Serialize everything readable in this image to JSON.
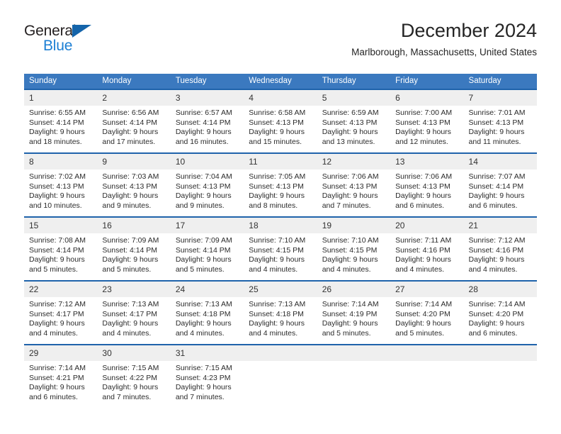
{
  "logo": {
    "word1": "General",
    "word2": "Blue",
    "triangle_color": "#1464aa",
    "blue_color": "#1c7fd4"
  },
  "header": {
    "title": "December 2024",
    "subtitle": "Marlborough, Massachusetts, United States"
  },
  "theme": {
    "header_bg": "#3b79bf",
    "row_divider": "#1f63ab",
    "daynum_bg": "#efefef",
    "text": "#2b2b2b"
  },
  "calendar": {
    "weekday_headers": [
      "Sunday",
      "Monday",
      "Tuesday",
      "Wednesday",
      "Thursday",
      "Friday",
      "Saturday"
    ],
    "weeks": [
      [
        {
          "day": "1",
          "sunrise": "Sunrise: 6:55 AM",
          "sunset": "Sunset: 4:14 PM",
          "daylight1": "Daylight: 9 hours",
          "daylight2": "and 18 minutes."
        },
        {
          "day": "2",
          "sunrise": "Sunrise: 6:56 AM",
          "sunset": "Sunset: 4:14 PM",
          "daylight1": "Daylight: 9 hours",
          "daylight2": "and 17 minutes."
        },
        {
          "day": "3",
          "sunrise": "Sunrise: 6:57 AM",
          "sunset": "Sunset: 4:14 PM",
          "daylight1": "Daylight: 9 hours",
          "daylight2": "and 16 minutes."
        },
        {
          "day": "4",
          "sunrise": "Sunrise: 6:58 AM",
          "sunset": "Sunset: 4:13 PM",
          "daylight1": "Daylight: 9 hours",
          "daylight2": "and 15 minutes."
        },
        {
          "day": "5",
          "sunrise": "Sunrise: 6:59 AM",
          "sunset": "Sunset: 4:13 PM",
          "daylight1": "Daylight: 9 hours",
          "daylight2": "and 13 minutes."
        },
        {
          "day": "6",
          "sunrise": "Sunrise: 7:00 AM",
          "sunset": "Sunset: 4:13 PM",
          "daylight1": "Daylight: 9 hours",
          "daylight2": "and 12 minutes."
        },
        {
          "day": "7",
          "sunrise": "Sunrise: 7:01 AM",
          "sunset": "Sunset: 4:13 PM",
          "daylight1": "Daylight: 9 hours",
          "daylight2": "and 11 minutes."
        }
      ],
      [
        {
          "day": "8",
          "sunrise": "Sunrise: 7:02 AM",
          "sunset": "Sunset: 4:13 PM",
          "daylight1": "Daylight: 9 hours",
          "daylight2": "and 10 minutes."
        },
        {
          "day": "9",
          "sunrise": "Sunrise: 7:03 AM",
          "sunset": "Sunset: 4:13 PM",
          "daylight1": "Daylight: 9 hours",
          "daylight2": "and 9 minutes."
        },
        {
          "day": "10",
          "sunrise": "Sunrise: 7:04 AM",
          "sunset": "Sunset: 4:13 PM",
          "daylight1": "Daylight: 9 hours",
          "daylight2": "and 9 minutes."
        },
        {
          "day": "11",
          "sunrise": "Sunrise: 7:05 AM",
          "sunset": "Sunset: 4:13 PM",
          "daylight1": "Daylight: 9 hours",
          "daylight2": "and 8 minutes."
        },
        {
          "day": "12",
          "sunrise": "Sunrise: 7:06 AM",
          "sunset": "Sunset: 4:13 PM",
          "daylight1": "Daylight: 9 hours",
          "daylight2": "and 7 minutes."
        },
        {
          "day": "13",
          "sunrise": "Sunrise: 7:06 AM",
          "sunset": "Sunset: 4:13 PM",
          "daylight1": "Daylight: 9 hours",
          "daylight2": "and 6 minutes."
        },
        {
          "day": "14",
          "sunrise": "Sunrise: 7:07 AM",
          "sunset": "Sunset: 4:14 PM",
          "daylight1": "Daylight: 9 hours",
          "daylight2": "and 6 minutes."
        }
      ],
      [
        {
          "day": "15",
          "sunrise": "Sunrise: 7:08 AM",
          "sunset": "Sunset: 4:14 PM",
          "daylight1": "Daylight: 9 hours",
          "daylight2": "and 5 minutes."
        },
        {
          "day": "16",
          "sunrise": "Sunrise: 7:09 AM",
          "sunset": "Sunset: 4:14 PM",
          "daylight1": "Daylight: 9 hours",
          "daylight2": "and 5 minutes."
        },
        {
          "day": "17",
          "sunrise": "Sunrise: 7:09 AM",
          "sunset": "Sunset: 4:14 PM",
          "daylight1": "Daylight: 9 hours",
          "daylight2": "and 5 minutes."
        },
        {
          "day": "18",
          "sunrise": "Sunrise: 7:10 AM",
          "sunset": "Sunset: 4:15 PM",
          "daylight1": "Daylight: 9 hours",
          "daylight2": "and 4 minutes."
        },
        {
          "day": "19",
          "sunrise": "Sunrise: 7:10 AM",
          "sunset": "Sunset: 4:15 PM",
          "daylight1": "Daylight: 9 hours",
          "daylight2": "and 4 minutes."
        },
        {
          "day": "20",
          "sunrise": "Sunrise: 7:11 AM",
          "sunset": "Sunset: 4:16 PM",
          "daylight1": "Daylight: 9 hours",
          "daylight2": "and 4 minutes."
        },
        {
          "day": "21",
          "sunrise": "Sunrise: 7:12 AM",
          "sunset": "Sunset: 4:16 PM",
          "daylight1": "Daylight: 9 hours",
          "daylight2": "and 4 minutes."
        }
      ],
      [
        {
          "day": "22",
          "sunrise": "Sunrise: 7:12 AM",
          "sunset": "Sunset: 4:17 PM",
          "daylight1": "Daylight: 9 hours",
          "daylight2": "and 4 minutes."
        },
        {
          "day": "23",
          "sunrise": "Sunrise: 7:13 AM",
          "sunset": "Sunset: 4:17 PM",
          "daylight1": "Daylight: 9 hours",
          "daylight2": "and 4 minutes."
        },
        {
          "day": "24",
          "sunrise": "Sunrise: 7:13 AM",
          "sunset": "Sunset: 4:18 PM",
          "daylight1": "Daylight: 9 hours",
          "daylight2": "and 4 minutes."
        },
        {
          "day": "25",
          "sunrise": "Sunrise: 7:13 AM",
          "sunset": "Sunset: 4:18 PM",
          "daylight1": "Daylight: 9 hours",
          "daylight2": "and 4 minutes."
        },
        {
          "day": "26",
          "sunrise": "Sunrise: 7:14 AM",
          "sunset": "Sunset: 4:19 PM",
          "daylight1": "Daylight: 9 hours",
          "daylight2": "and 5 minutes."
        },
        {
          "day": "27",
          "sunrise": "Sunrise: 7:14 AM",
          "sunset": "Sunset: 4:20 PM",
          "daylight1": "Daylight: 9 hours",
          "daylight2": "and 5 minutes."
        },
        {
          "day": "28",
          "sunrise": "Sunrise: 7:14 AM",
          "sunset": "Sunset: 4:20 PM",
          "daylight1": "Daylight: 9 hours",
          "daylight2": "and 6 minutes."
        }
      ],
      [
        {
          "day": "29",
          "sunrise": "Sunrise: 7:14 AM",
          "sunset": "Sunset: 4:21 PM",
          "daylight1": "Daylight: 9 hours",
          "daylight2": "and 6 minutes."
        },
        {
          "day": "30",
          "sunrise": "Sunrise: 7:15 AM",
          "sunset": "Sunset: 4:22 PM",
          "daylight1": "Daylight: 9 hours",
          "daylight2": "and 7 minutes."
        },
        {
          "day": "31",
          "sunrise": "Sunrise: 7:15 AM",
          "sunset": "Sunset: 4:23 PM",
          "daylight1": "Daylight: 9 hours",
          "daylight2": "and 7 minutes."
        },
        {
          "day": "",
          "sunrise": "",
          "sunset": "",
          "daylight1": "",
          "daylight2": ""
        },
        {
          "day": "",
          "sunrise": "",
          "sunset": "",
          "daylight1": "",
          "daylight2": ""
        },
        {
          "day": "",
          "sunrise": "",
          "sunset": "",
          "daylight1": "",
          "daylight2": ""
        },
        {
          "day": "",
          "sunrise": "",
          "sunset": "",
          "daylight1": "",
          "daylight2": ""
        }
      ]
    ]
  }
}
